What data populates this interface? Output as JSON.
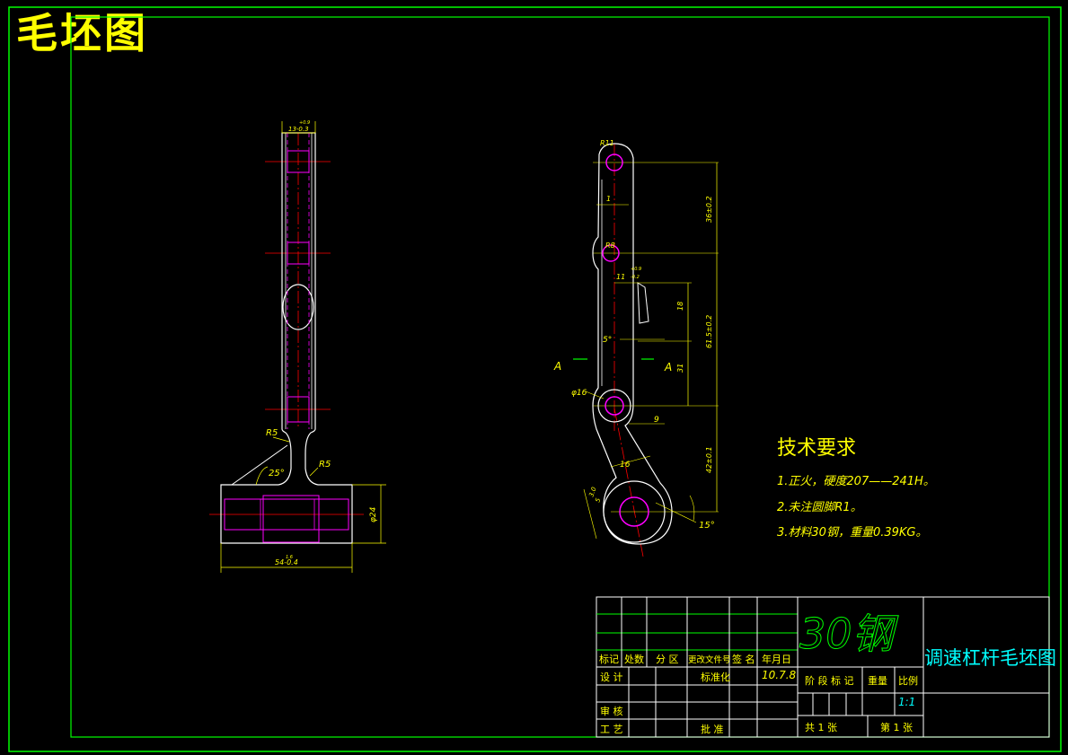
{
  "title": "毛坯图",
  "colors": {
    "frame": "#00ff00",
    "outline": "#ffffff",
    "dimension": "#ffff00",
    "hidden": "#ff00ff",
    "center": "#ff0000",
    "titleblock": "#00ff00",
    "text_cyan": "#00ffff"
  },
  "left_view": {
    "dim_top": "13-0.3",
    "dim_top_tol": "+0.9",
    "r5_left": "R5",
    "r5_right": "R5",
    "angle": "25°",
    "dim_dia": "φ24",
    "dim_bottom": "54-0.4",
    "dim_bottom_tol": "1.6"
  },
  "right_view": {
    "r_top": "R11",
    "r_mid": "R8",
    "dim_1": "1",
    "dim_36": "36±0.2",
    "dim_11": "11",
    "dim_tol_small": "+0.9",
    "dim_tol_small2": "-0.2",
    "dim_18": "18",
    "dim_61": "61.5±0.2",
    "angle_5": "5°",
    "section_a_left": "A",
    "section_a_right": "A",
    "dim_31": "31",
    "dia_16": "φ16",
    "dim_9": "9",
    "dim_42": "42±0.1",
    "dim_16": "16",
    "dim_r_small": "3.0",
    "dim_5": "5",
    "angle_15": "15°"
  },
  "tech_req": {
    "heading": "技术要求",
    "items": [
      "1.正火，硬度207——241H。",
      "2.未注圆脚R1。",
      "3.材料30钢，重量0.39KG。"
    ]
  },
  "title_block": {
    "material": "30钢",
    "drawing_name": "调速杠杆毛坯图",
    "col_labels": [
      "标记",
      "处数",
      "分 区",
      "更改文件号",
      "签 名",
      "年月日"
    ],
    "design": "设 计",
    "standard": "标准化",
    "date": "10.7.8",
    "stage_mark": "阶 段 标 记",
    "weight": "重量",
    "scale": "比例",
    "scale_value": "1:1",
    "review": "审 核",
    "process": "工 艺",
    "approve": "批 准",
    "total_sheets": "共 1 张",
    "sheet_no": "第 1 张"
  }
}
